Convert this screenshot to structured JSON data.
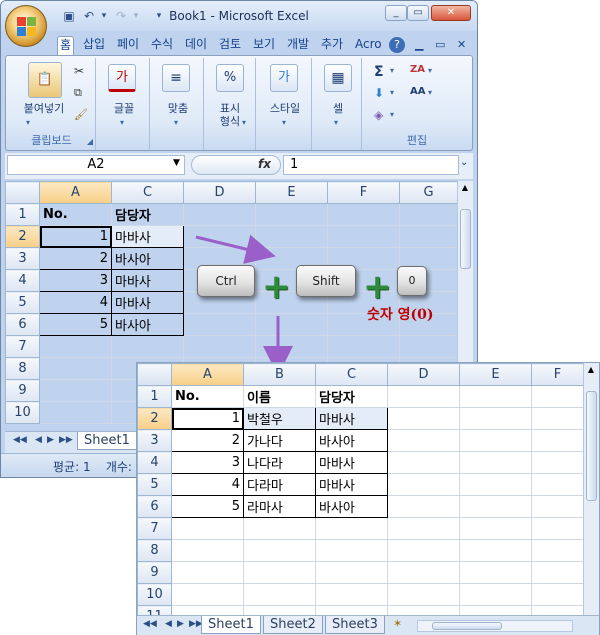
{
  "window": {
    "title": "Book1 - Microsoft Excel",
    "qat_icons": [
      "save-icon",
      "undo-icon",
      "redo-icon",
      "customize-icon"
    ],
    "controls": {
      "minimize": "_",
      "restore": "▭",
      "close": "✕"
    }
  },
  "ribbon": {
    "tabs": [
      "홈",
      "삽입",
      "페이",
      "수식",
      "데이",
      "검토",
      "보기",
      "개발",
      "추가",
      "Acro"
    ],
    "active_tab": "홈",
    "help": "?",
    "groups": {
      "clipboard": {
        "paste_label": "붙여넣기",
        "label": "클립보드"
      },
      "font_label": "글꼴",
      "font_icon": "가",
      "align_label": "맞춤",
      "number": {
        "label": "표시\n형식",
        "icon": "%"
      },
      "style": {
        "label": "스타일",
        "icon": "가"
      },
      "cells_label": "셀",
      "editing": {
        "label": "편집",
        "sum_icon": "Σ",
        "sort_icon": "ZA",
        "find_icon": "AA"
      }
    }
  },
  "formula_bar": {
    "name_box": "A2",
    "fx": "fx",
    "value": "1"
  },
  "sheet1": {
    "column_headers": [
      "A",
      "C",
      "D",
      "E",
      "F",
      "G"
    ],
    "row_headers": [
      "1",
      "2",
      "3",
      "4",
      "5",
      "6",
      "7",
      "8",
      "9",
      "10"
    ],
    "rows": [
      [
        "No.",
        "담당자"
      ],
      [
        "1",
        "마바사"
      ],
      [
        "2",
        "바사아"
      ],
      [
        "3",
        "마바사"
      ],
      [
        "4",
        "마바사"
      ],
      [
        "5",
        "바사아"
      ]
    ],
    "sheet_tab": "Sheet1",
    "status": "평균: 1    개수:"
  },
  "shortcut": {
    "keys": [
      "Ctrl",
      "Shift",
      "0"
    ],
    "plus": "+",
    "caption": "숫자 영(0)"
  },
  "sheet2": {
    "column_headers": [
      "A",
      "B",
      "C",
      "D",
      "E",
      "F"
    ],
    "row_headers": [
      "1",
      "2",
      "3",
      "4",
      "5",
      "6",
      "7",
      "8",
      "9",
      "10",
      "11"
    ],
    "rows": [
      [
        "No.",
        "이름",
        "담당자"
      ],
      [
        "1",
        "박철우",
        "마바사"
      ],
      [
        "2",
        "가나다",
        "바사아"
      ],
      [
        "3",
        "나다라",
        "마바사"
      ],
      [
        "4",
        "다라마",
        "마바사"
      ],
      [
        "5",
        "라마사",
        "바사아"
      ]
    ],
    "sheet_tabs": [
      "Sheet1",
      "Sheet2",
      "Sheet3"
    ]
  },
  "colors": {
    "arrow": "#9a5fc8",
    "caption": "#c00000",
    "plus": "#2e8b3a"
  }
}
